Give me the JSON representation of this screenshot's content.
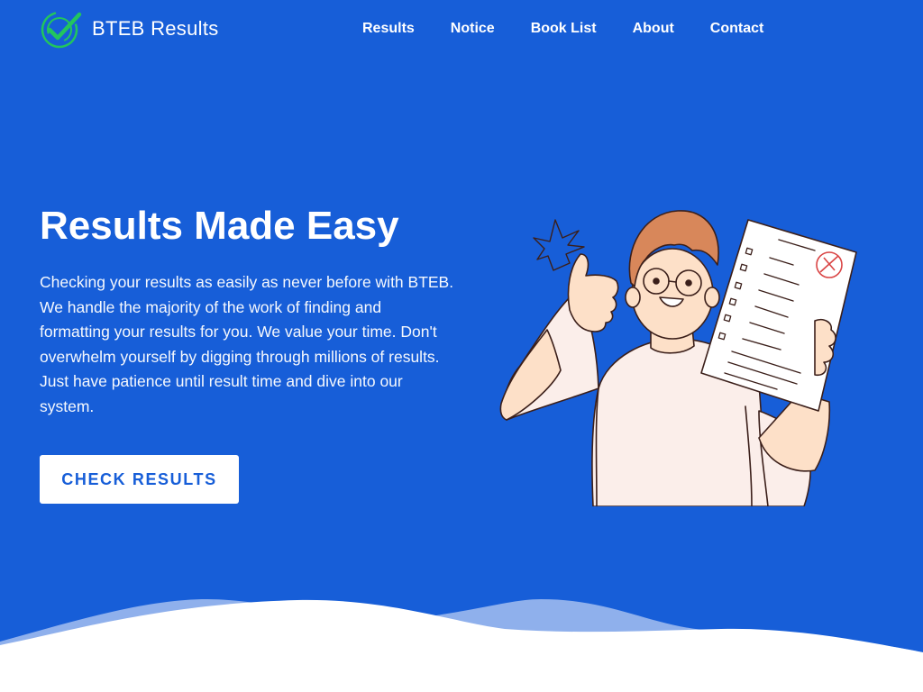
{
  "brand": {
    "name": "BTEB Results",
    "icon": "check-circle-icon",
    "icon_color": "#22c55e"
  },
  "nav": {
    "items": [
      {
        "label": "Results"
      },
      {
        "label": "Notice"
      },
      {
        "label": "Book List"
      },
      {
        "label": "About"
      },
      {
        "label": "Contact"
      }
    ]
  },
  "hero": {
    "title": "Results Made Easy",
    "description": "Checking your results as easily as never before with BTEB. We handle the majority of the work of finding and formatting your results for you. We value your time. Don't overwhelm yourself by digging through millions of results. Just have patience until result time and dive into our system.",
    "cta_label": "CHECK RESULTS",
    "illustration": "student-thumbs-up-with-result-sheet"
  },
  "colors": {
    "primary": "#175ed8",
    "wave_light": "#8fb0ec",
    "background": "#ffffff",
    "accent_green": "#22c55e"
  }
}
